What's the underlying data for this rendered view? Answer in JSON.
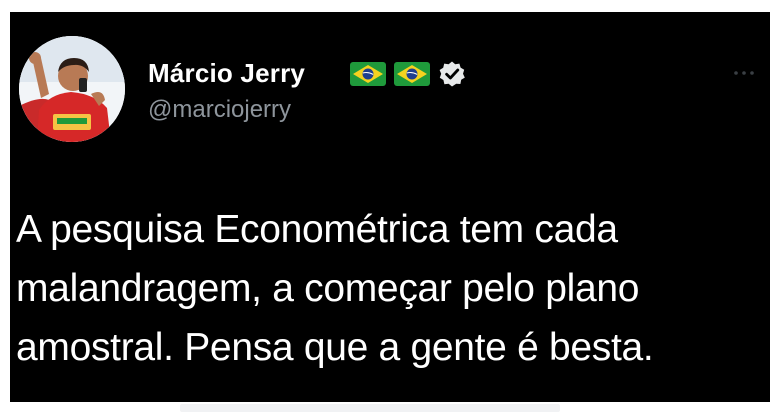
{
  "tweet": {
    "author": {
      "display_name": "Márcio Jerry",
      "handle": "@marciojerry",
      "verified": true,
      "name_flags": [
        "brazil-flag-icon",
        "brazil-flag-icon"
      ]
    },
    "text_lines": [
      "A pesquisa Econométrica tem cada",
      "malandragem, a começar pelo plano",
      "amostral. Pensa que a gente é besta."
    ],
    "menu_icon": "more-options-icon"
  },
  "colors": {
    "card_background": "#000000",
    "name_text": "#ffffff",
    "handle_text": "#8e959c",
    "body_text": "#ffffff",
    "flag_green": "#1f9a3b",
    "flag_yellow": "#f4d21f",
    "flag_blue": "#1f3f8f"
  }
}
